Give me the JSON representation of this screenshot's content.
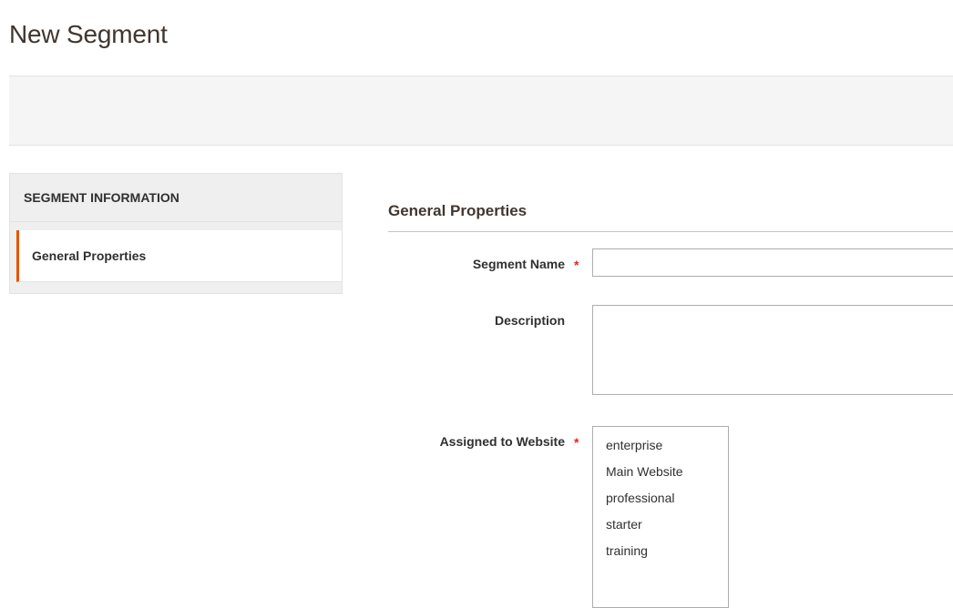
{
  "page": {
    "title": "New Segment"
  },
  "sidebar": {
    "title": "SEGMENT INFORMATION",
    "items": [
      {
        "label": "General Properties",
        "active": true
      }
    ]
  },
  "form": {
    "section_title": "General Properties",
    "segment_name": {
      "label": "Segment Name",
      "required": true,
      "required_mark": "*",
      "value": ""
    },
    "description": {
      "label": "Description",
      "value": ""
    },
    "assigned_to_website": {
      "label": "Assigned to Website",
      "required": true,
      "required_mark": "*",
      "options": [
        "enterprise",
        "Main Website",
        "professional",
        "starter",
        "training"
      ],
      "selected": []
    }
  },
  "colors": {
    "accent": "#eb5202",
    "required": "#e22626",
    "title": "#41362f"
  }
}
